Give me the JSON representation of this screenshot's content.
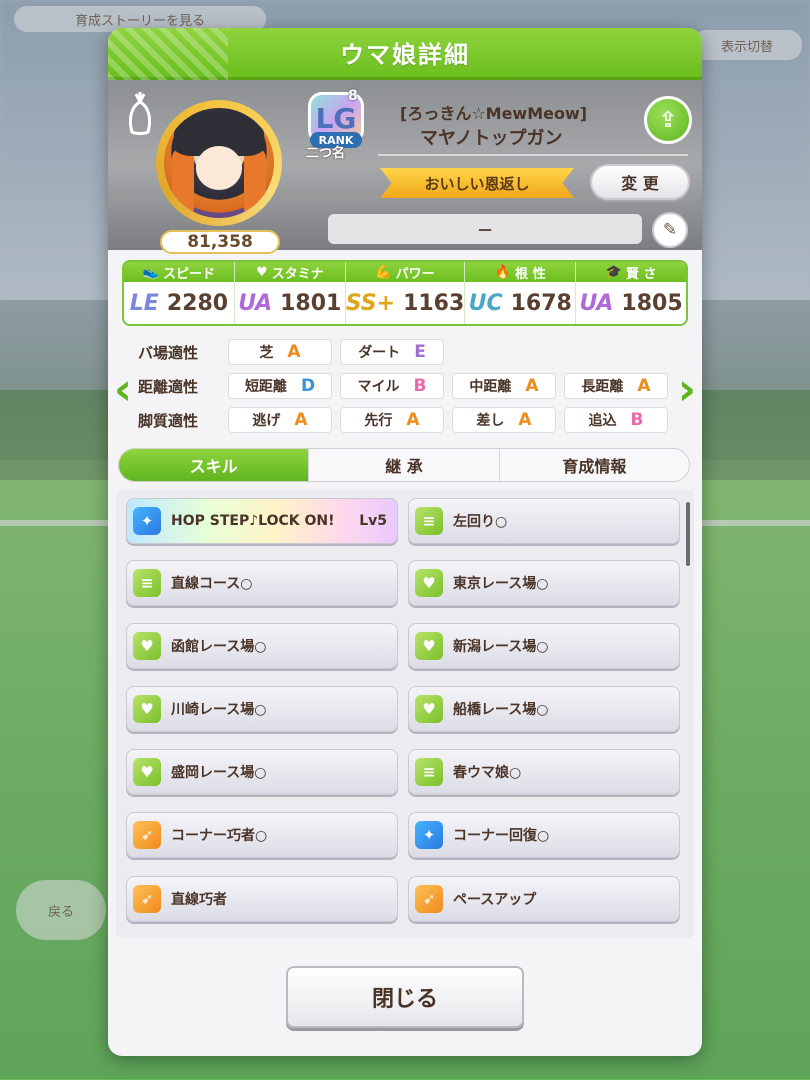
{
  "background": {
    "top_left_chip": "育成ストーリーを見る",
    "top_right_chip": "表示切替",
    "left_chip": "戻る"
  },
  "modal": {
    "title": "ウマ娘詳細",
    "close_label": "閉じる"
  },
  "profile": {
    "score": "81,358",
    "rank": {
      "letters": "LG",
      "number": "8",
      "label": "RANK"
    },
    "nickname": "二つ名",
    "title_line1": "[ろっきん☆MewMeow]",
    "title_line2": "マヤノトップガン",
    "ribbon_title": "おいしい恩返し",
    "change_label": "変 更",
    "comment": "－"
  },
  "stats": [
    {
      "label": "スピード",
      "icon": "shoe-icon",
      "grade": "LE",
      "value": "2280"
    },
    {
      "label": "スタミナ",
      "icon": "heart-icon",
      "grade": "UA",
      "value": "1801"
    },
    {
      "label": "パワー",
      "icon": "muscle-icon",
      "grade": "SS+",
      "value": "1163"
    },
    {
      "label": "根 性",
      "icon": "flame-icon",
      "grade": "UC",
      "value": "1678"
    },
    {
      "label": "賢 さ",
      "icon": "cap-icon",
      "grade": "UA",
      "value": "1805"
    }
  ],
  "aptitude": {
    "track_label": "バ場適性",
    "track": [
      {
        "name": "芝",
        "grade": "A"
      },
      {
        "name": "ダート",
        "grade": "E"
      }
    ],
    "distance_label": "距離適性",
    "distance": [
      {
        "name": "短距離",
        "grade": "D"
      },
      {
        "name": "マイル",
        "grade": "B"
      },
      {
        "name": "中距離",
        "grade": "A"
      },
      {
        "name": "長距離",
        "grade": "A"
      }
    ],
    "style_label": "脚質適性",
    "style": [
      {
        "name": "逃げ",
        "grade": "A"
      },
      {
        "name": "先行",
        "grade": "A"
      },
      {
        "name": "差し",
        "grade": "A"
      },
      {
        "name": "追込",
        "grade": "B"
      }
    ]
  },
  "tabs": [
    "スキル",
    "継 承",
    "育成情報"
  ],
  "skills": [
    {
      "name": "HOP STEP♪LOCK ON!",
      "level": "Lv5",
      "icon": "sparkle-icon",
      "color": "blue"
    },
    {
      "name": "左回り○",
      "icon": "card-icon",
      "color": "green"
    },
    {
      "name": "直線コース○",
      "icon": "card-icon",
      "color": "green"
    },
    {
      "name": "東京レース場○",
      "icon": "heart-icon",
      "color": "green"
    },
    {
      "name": "函館レース場○",
      "icon": "heart-icon",
      "color": "green"
    },
    {
      "name": "新潟レース場○",
      "icon": "heart-icon",
      "color": "green"
    },
    {
      "name": "川崎レース場○",
      "icon": "heart-icon",
      "color": "green"
    },
    {
      "name": "船橋レース場○",
      "icon": "heart-icon",
      "color": "green"
    },
    {
      "name": "盛岡レース場○",
      "icon": "heart-icon",
      "color": "green"
    },
    {
      "name": "春ウマ娘○",
      "icon": "card-icon",
      "color": "green"
    },
    {
      "name": "コーナー巧者○",
      "icon": "runner-icon",
      "color": "orange"
    },
    {
      "name": "コーナー回復○",
      "icon": "sparkle-icon",
      "color": "blue"
    },
    {
      "name": "直線巧者",
      "icon": "runner-icon",
      "color": "orange"
    },
    {
      "name": "ペースアップ",
      "icon": "runner-icon",
      "color": "orange"
    }
  ]
}
